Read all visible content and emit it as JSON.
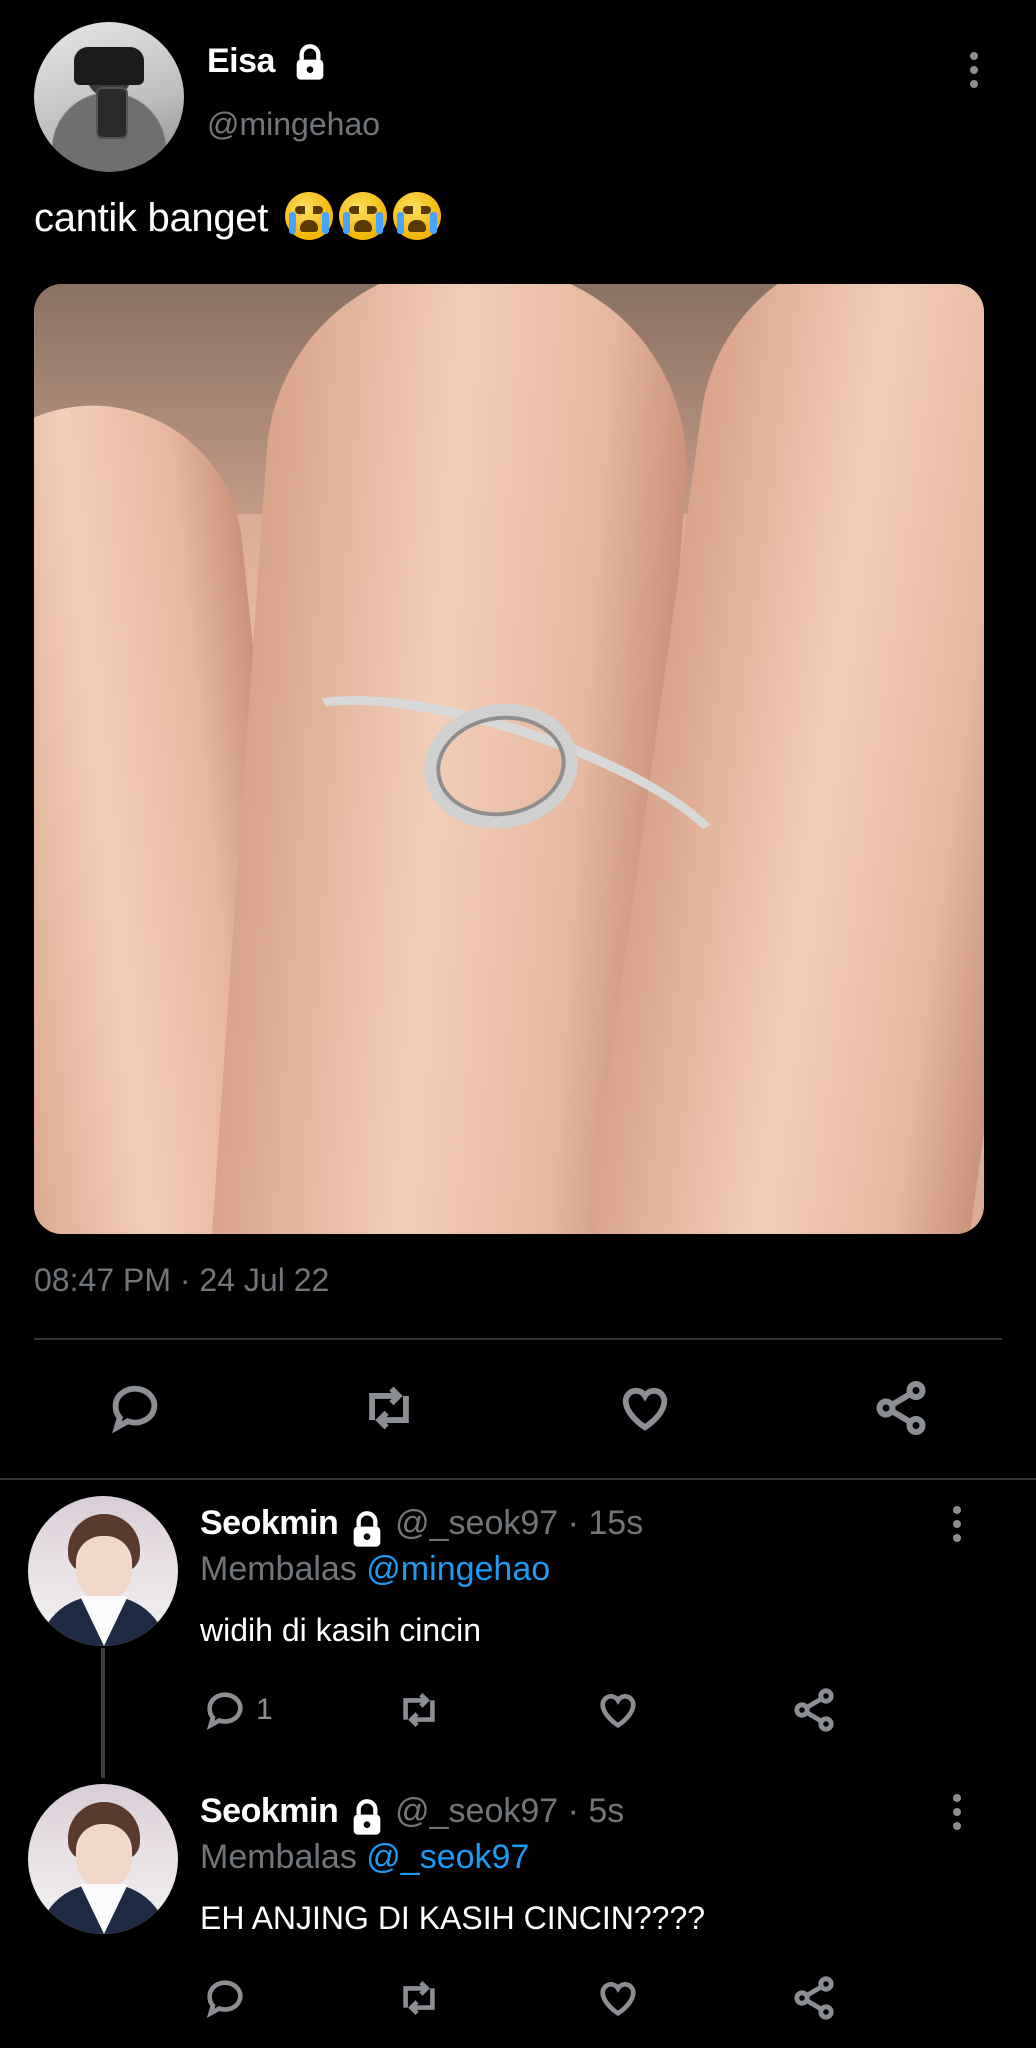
{
  "main_tweet": {
    "display_name": "Eisa",
    "handle": "@mingehao",
    "text": "cantik banget",
    "emoji": [
      "loudly-crying-face",
      "loudly-crying-face",
      "loudly-crying-face"
    ],
    "image_description_icon": "ring-photo",
    "timestamp": "08:47 PM · 24 Jul 22",
    "actions": [
      "reply-icon",
      "retweet-icon",
      "like-icon",
      "share-icon"
    ]
  },
  "replies": [
    {
      "display_name": "Seokmin",
      "handle_time": "@_seok97 · 15s",
      "replying_prefix": "Membalas",
      "replying_to": "@mingehao",
      "text": "widih di kasih cincin",
      "reply_count": "1"
    },
    {
      "display_name": "Seokmin",
      "handle_time": "@_seok97 · 5s",
      "replying_prefix": "Membalas",
      "replying_to": "@_seok97",
      "text": "EH ANJING DI KASIH CINCIN????",
      "reply_count": ""
    }
  ],
  "colors": {
    "background": "#000000",
    "text": "#ffffff",
    "secondary": "#71767b",
    "link": "#1d9bf0",
    "divider": "#2f3336"
  }
}
